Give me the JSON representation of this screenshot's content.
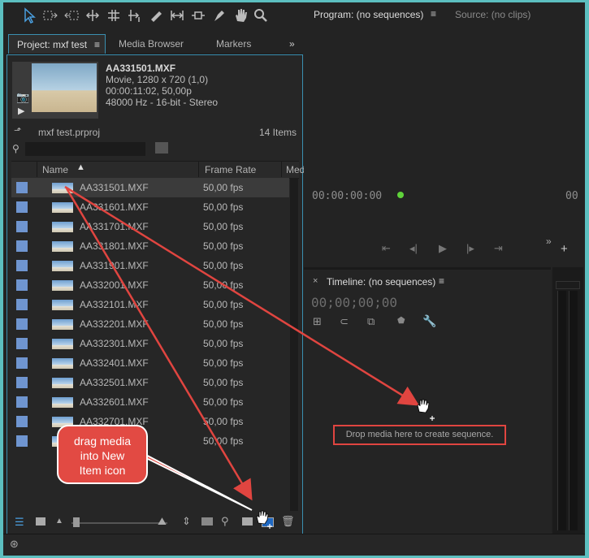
{
  "toolbar": {
    "icons": [
      "selection-tool",
      "track-select-forward",
      "track-select-backward",
      "ripple-edit",
      "rolling-edit",
      "rate-stretch",
      "razor",
      "slip",
      "slide",
      "pen",
      "hand",
      "zoom"
    ]
  },
  "project": {
    "tabs": [
      {
        "label": "Project: mxf test",
        "active": true
      },
      {
        "label": "Media Browser",
        "active": false
      },
      {
        "label": "Markers",
        "active": false
      }
    ],
    "clip": {
      "name": "AA331501.MXF",
      "info1": "Movie, 1280 x 720 (1,0)",
      "info2": "00:00:11:02, 50,00p",
      "info3": "48000 Hz - 16-bit - Stereo"
    },
    "file": "mxf test.prproj",
    "count": "14 Items",
    "columns": {
      "name": "Name",
      "frame_rate": "Frame Rate",
      "media": "Med"
    },
    "items": [
      {
        "name": "AA331501.MXF",
        "fps": "50,00 fps"
      },
      {
        "name": "AA331601.MXF",
        "fps": "50,00 fps"
      },
      {
        "name": "AA331701.MXF",
        "fps": "50,00 fps"
      },
      {
        "name": "AA331801.MXF",
        "fps": "50,00 fps"
      },
      {
        "name": "AA331901.MXF",
        "fps": "50,00 fps"
      },
      {
        "name": "AA332001.MXF",
        "fps": "50,00 fps"
      },
      {
        "name": "AA332101.MXF",
        "fps": "50,00 fps"
      },
      {
        "name": "AA332201.MXF",
        "fps": "50,00 fps"
      },
      {
        "name": "AA332301.MXF",
        "fps": "50,00 fps"
      },
      {
        "name": "AA332401.MXF",
        "fps": "50,00 fps"
      },
      {
        "name": "AA332501.MXF",
        "fps": "50,00 fps"
      },
      {
        "name": "AA332601.MXF",
        "fps": "50,00 fps"
      },
      {
        "name": "AA332701.MXF",
        "fps": "50,00 fps"
      },
      {
        "name": "",
        "fps": "50,00 fps"
      }
    ]
  },
  "program": {
    "title": "Program: (no sequences)",
    "source": "Source: (no clips)",
    "timecode": "00:00:00:00",
    "timecode_right": "00"
  },
  "timeline": {
    "title": "Timeline: (no sequences)",
    "timecode": "00;00;00;00",
    "drop_text": "Drop media here to create sequence."
  },
  "callout": {
    "lines": [
      "drag media",
      "into New",
      "Item icon"
    ]
  },
  "colors": {
    "accent": "#3a8fb0",
    "annotation": "#e04540",
    "checkbox": "#6f95d0",
    "indicator": "#5fd23a"
  }
}
